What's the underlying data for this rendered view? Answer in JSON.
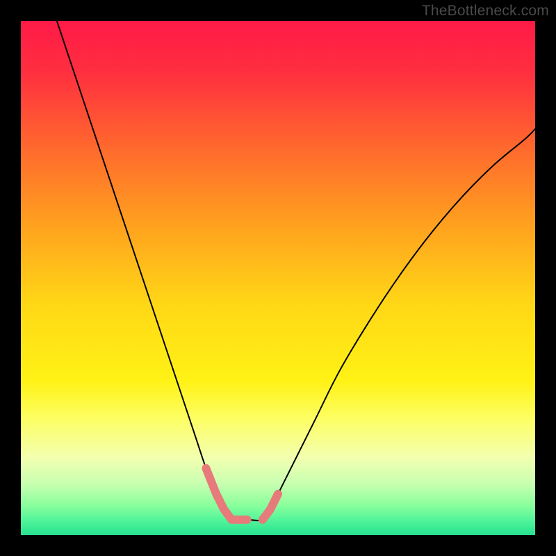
{
  "watermark": "TheBottleneck.com",
  "chart_data": {
    "type": "line",
    "title": "",
    "xlabel": "",
    "ylabel": "",
    "xlim": [
      0,
      100
    ],
    "ylim": [
      0,
      100
    ],
    "background_gradient": {
      "stops": [
        {
          "offset": 0.0,
          "color": "#ff1a47"
        },
        {
          "offset": 0.1,
          "color": "#ff2f3f"
        },
        {
          "offset": 0.25,
          "color": "#ff6a2d"
        },
        {
          "offset": 0.4,
          "color": "#ffa21e"
        },
        {
          "offset": 0.55,
          "color": "#ffd716"
        },
        {
          "offset": 0.7,
          "color": "#fff215"
        },
        {
          "offset": 0.78,
          "color": "#fdff6a"
        },
        {
          "offset": 0.85,
          "color": "#f2ffb0"
        },
        {
          "offset": 0.9,
          "color": "#c8ffb0"
        },
        {
          "offset": 0.94,
          "color": "#8dff9d"
        },
        {
          "offset": 0.97,
          "color": "#53f59a"
        },
        {
          "offset": 1.0,
          "color": "#27e08f"
        }
      ]
    },
    "series": [
      {
        "name": "bottleneck-curve",
        "color": "#000000",
        "stroke_width": 2,
        "x": [
          7,
          10,
          13,
          16,
          19,
          22,
          25,
          28,
          31,
          34,
          36,
          38,
          39.5,
          41,
          44,
          47,
          48.5,
          50,
          53,
          57,
          62,
          68,
          74,
          80,
          86,
          92,
          98,
          100
        ],
        "y": [
          100,
          91,
          82,
          73,
          64,
          55,
          46,
          37,
          28,
          19,
          13,
          8,
          5,
          3,
          3,
          3,
          5,
          8,
          14,
          22,
          32,
          42,
          51,
          59,
          66,
          72,
          77,
          79
        ]
      }
    ],
    "markers": [
      {
        "name": "bottom-left-marker",
        "type": "round-cap",
        "color": "#e77a7a",
        "stroke_width": 12,
        "x": [
          36.0,
          38.0,
          39.5,
          41.0,
          44.0
        ],
        "y": [
          13.0,
          8.0,
          5.0,
          3.0,
          3.0
        ]
      },
      {
        "name": "bottom-right-marker",
        "type": "round-cap",
        "color": "#e77a7a",
        "stroke_width": 12,
        "x": [
          47.0,
          48.5,
          50.0
        ],
        "y": [
          3.0,
          5.0,
          8.0
        ]
      }
    ]
  }
}
